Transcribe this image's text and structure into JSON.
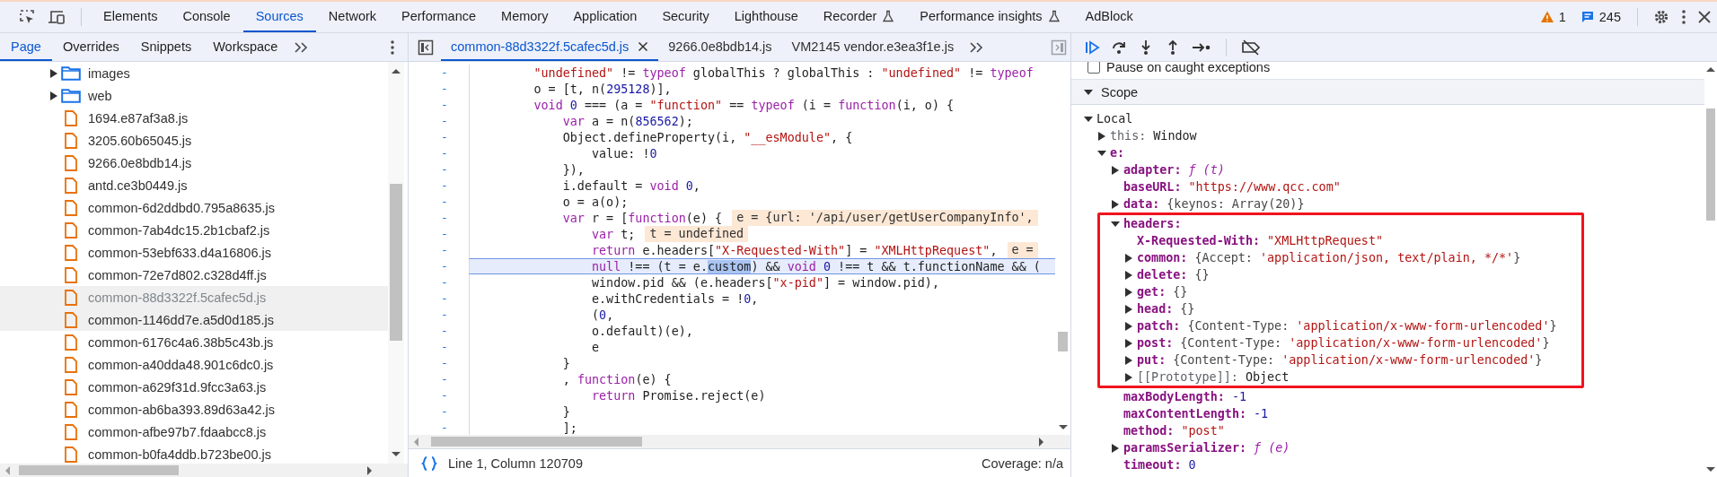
{
  "main_tabs": [
    {
      "label": "Elements",
      "selected": false,
      "experimental": false
    },
    {
      "label": "Console",
      "selected": false,
      "experimental": false
    },
    {
      "label": "Sources",
      "selected": true,
      "experimental": false
    },
    {
      "label": "Network",
      "selected": false,
      "experimental": false
    },
    {
      "label": "Performance",
      "selected": false,
      "experimental": false
    },
    {
      "label": "Memory",
      "selected": false,
      "experimental": false
    },
    {
      "label": "Application",
      "selected": false,
      "experimental": false
    },
    {
      "label": "Security",
      "selected": false,
      "experimental": false
    },
    {
      "label": "Lighthouse",
      "selected": false,
      "experimental": false
    },
    {
      "label": "Recorder",
      "selected": false,
      "experimental": true
    },
    {
      "label": "Performance insights",
      "selected": false,
      "experimental": true
    },
    {
      "label": "AdBlock",
      "selected": false,
      "experimental": false
    }
  ],
  "issues": {
    "warnings": "1",
    "messages": "245"
  },
  "navigator": {
    "tabs": [
      {
        "label": "Page",
        "selected": true
      },
      {
        "label": "Overrides",
        "selected": false
      },
      {
        "label": "Snippets",
        "selected": false
      },
      {
        "label": "Workspace",
        "selected": false
      }
    ],
    "tree": [
      {
        "kind": "folder",
        "name": "images",
        "expanded": false,
        "selected": false,
        "hovered": false
      },
      {
        "kind": "folder",
        "name": "web",
        "expanded": false,
        "selected": false,
        "hovered": false
      },
      {
        "kind": "file",
        "name": "1694.e87af3a8.js",
        "selected": false,
        "hovered": false
      },
      {
        "kind": "file",
        "name": "3205.60b65045.js",
        "selected": false,
        "hovered": false
      },
      {
        "kind": "file",
        "name": "9266.0e8bdb14.js",
        "selected": false,
        "hovered": false
      },
      {
        "kind": "file",
        "name": "antd.ce3b0449.js",
        "selected": false,
        "hovered": false
      },
      {
        "kind": "file",
        "name": "common-6d2ddbd0.795a8635.js",
        "selected": false,
        "hovered": false
      },
      {
        "kind": "file",
        "name": "common-7ab4dc15.2b1cbaf2.js",
        "selected": false,
        "hovered": false
      },
      {
        "kind": "file",
        "name": "common-53ebf633.d4a16806.js",
        "selected": false,
        "hovered": false
      },
      {
        "kind": "file",
        "name": "common-72e7d802.c328d4ff.js",
        "selected": false,
        "hovered": false
      },
      {
        "kind": "file",
        "name": "common-88d3322f.5cafec5d.js",
        "selected": true,
        "hovered": false
      },
      {
        "kind": "file",
        "name": "common-1146dd7e.a5d0d185.js",
        "selected": false,
        "hovered": true
      },
      {
        "kind": "file",
        "name": "common-6176c4a6.38b5c43b.js",
        "selected": false,
        "hovered": false
      },
      {
        "kind": "file",
        "name": "common-a40dda48.901c6dc0.js",
        "selected": false,
        "hovered": false
      },
      {
        "kind": "file",
        "name": "common-a629f31d.9fcc3a63.js",
        "selected": false,
        "hovered": false
      },
      {
        "kind": "file",
        "name": "common-ab6ba393.89d63a42.js",
        "selected": false,
        "hovered": false
      },
      {
        "kind": "file",
        "name": "common-afbe97b7.fdaabcc8.js",
        "selected": false,
        "hovered": false
      },
      {
        "kind": "file",
        "name": "common-b0fa4ddb.b723be00.js",
        "selected": false,
        "hovered": false
      }
    ]
  },
  "editor": {
    "tabs": [
      {
        "label": "common-88d3322f.5cafec5d.js",
        "selected": true
      },
      {
        "label": "9266.0e8bdb14.js",
        "selected": false
      },
      {
        "label": "VM2145 vendor.e3ea3f1e.js",
        "selected": false
      }
    ],
    "lines": [
      {
        "marker": "-",
        "current": false,
        "tokens": [
          {
            "kind": "string",
            "text": "        \"undefined\""
          },
          {
            "kind": "plain",
            "text": " != "
          },
          {
            "kind": "keyword",
            "text": "typeof"
          },
          {
            "kind": "plain",
            "text": " globalThis ? globalThis : "
          },
          {
            "kind": "string",
            "text": "\"undefined\""
          },
          {
            "kind": "plain",
            "text": " != "
          },
          {
            "kind": "keyword",
            "text": "typeof"
          }
        ]
      },
      {
        "marker": "-",
        "current": false,
        "tokens": [
          {
            "kind": "plain",
            "text": "        o = [t, n("
          },
          {
            "kind": "number",
            "text": "295128"
          },
          {
            "kind": "plain",
            "text": ")],"
          }
        ]
      },
      {
        "marker": "-",
        "current": false,
        "tokens": [
          {
            "kind": "keyword",
            "text": "        void "
          },
          {
            "kind": "number",
            "text": "0"
          },
          {
            "kind": "plain",
            "text": " === (a = "
          },
          {
            "kind": "string",
            "text": "\"function\""
          },
          {
            "kind": "plain",
            "text": " == "
          },
          {
            "kind": "keyword",
            "text": "typeof"
          },
          {
            "kind": "plain",
            "text": " (i = "
          },
          {
            "kind": "keyword",
            "text": "function"
          },
          {
            "kind": "plain",
            "text": "(i, o) {"
          }
        ]
      },
      {
        "marker": "-",
        "current": false,
        "tokens": [
          {
            "kind": "keyword",
            "text": "            var"
          },
          {
            "kind": "plain",
            "text": " a = n("
          },
          {
            "kind": "number",
            "text": "856562"
          },
          {
            "kind": "plain",
            "text": ");"
          }
        ]
      },
      {
        "marker": "-",
        "current": false,
        "tokens": [
          {
            "kind": "plain",
            "text": "            Object.defineProperty(i, "
          },
          {
            "kind": "string",
            "text": "\"__esModule\""
          },
          {
            "kind": "plain",
            "text": ", {"
          }
        ]
      },
      {
        "marker": "-",
        "current": false,
        "tokens": [
          {
            "kind": "plain",
            "text": "                value: !"
          },
          {
            "kind": "number",
            "text": "0"
          }
        ]
      },
      {
        "marker": "-",
        "current": false,
        "tokens": [
          {
            "kind": "plain",
            "text": "            }),"
          }
        ]
      },
      {
        "marker": "-",
        "current": false,
        "tokens": [
          {
            "kind": "plain",
            "text": "            i.default = "
          },
          {
            "kind": "keyword",
            "text": "void "
          },
          {
            "kind": "number",
            "text": "0"
          },
          {
            "kind": "plain",
            "text": ","
          }
        ]
      },
      {
        "marker": "-",
        "current": false,
        "tokens": [
          {
            "kind": "plain",
            "text": "            o = a(o);"
          }
        ]
      },
      {
        "marker": "-",
        "current": false,
        "tokens": [
          {
            "kind": "keyword",
            "text": "            var"
          },
          {
            "kind": "plain",
            "text": " r = ["
          },
          {
            "kind": "keyword",
            "text": "function"
          },
          {
            "kind": "plain",
            "text": "(e) {"
          }
        ],
        "inline_value": "e = {url: '/api/user/getUserCompanyInfo',"
      },
      {
        "marker": "-",
        "current": false,
        "tokens": [
          {
            "kind": "keyword",
            "text": "                var"
          },
          {
            "kind": "plain",
            "text": " t;"
          }
        ],
        "inline_value": "t = undefined"
      },
      {
        "marker": "-",
        "current": false,
        "tokens": [
          {
            "kind": "keyword",
            "text": "                return"
          },
          {
            "kind": "plain",
            "text": " e.headers["
          },
          {
            "kind": "string",
            "text": "\"X-Requested-With\""
          },
          {
            "kind": "plain",
            "text": "] = "
          },
          {
            "kind": "string",
            "text": "\"XMLHttpRequest\""
          },
          {
            "kind": "plain",
            "text": ","
          }
        ],
        "inline_value": "e ="
      },
      {
        "marker": "-",
        "current": true,
        "tokens": [
          {
            "kind": "keyword",
            "text": "                null"
          },
          {
            "kind": "plain",
            "text": " !== (t = e."
          },
          {
            "kind": "selection",
            "text": "custom"
          },
          {
            "kind": "plain",
            "text": ") && "
          },
          {
            "kind": "keyword",
            "text": "void "
          },
          {
            "kind": "number",
            "text": "0"
          },
          {
            "kind": "plain",
            "text": " !== t && t.functionName && ("
          }
        ]
      },
      {
        "marker": "-",
        "current": false,
        "tokens": [
          {
            "kind": "plain",
            "text": "                window.pid && (e.headers["
          },
          {
            "kind": "string",
            "text": "\"x-pid\""
          },
          {
            "kind": "plain",
            "text": "] = window.pid),"
          }
        ]
      },
      {
        "marker": "-",
        "current": false,
        "tokens": [
          {
            "kind": "plain",
            "text": "                e.withCredentials = !"
          },
          {
            "kind": "number",
            "text": "0"
          },
          {
            "kind": "plain",
            "text": ","
          }
        ]
      },
      {
        "marker": "-",
        "current": false,
        "tokens": [
          {
            "kind": "plain",
            "text": "                ("
          },
          {
            "kind": "number",
            "text": "0"
          },
          {
            "kind": "plain",
            "text": ","
          }
        ]
      },
      {
        "marker": "-",
        "current": false,
        "tokens": [
          {
            "kind": "plain",
            "text": "                o.default)(e),"
          }
        ]
      },
      {
        "marker": "-",
        "current": false,
        "tokens": [
          {
            "kind": "plain",
            "text": "                e"
          }
        ]
      },
      {
        "marker": "-",
        "current": false,
        "tokens": [
          {
            "kind": "plain",
            "text": "            }"
          }
        ]
      },
      {
        "marker": "-",
        "current": false,
        "tokens": [
          {
            "kind": "plain",
            "text": "            , "
          },
          {
            "kind": "keyword",
            "text": "function"
          },
          {
            "kind": "plain",
            "text": "(e) {"
          }
        ]
      },
      {
        "marker": "-",
        "current": false,
        "tokens": [
          {
            "kind": "keyword",
            "text": "                return"
          },
          {
            "kind": "plain",
            "text": " Promise.reject(e)"
          }
        ]
      },
      {
        "marker": "-",
        "current": false,
        "tokens": [
          {
            "kind": "plain",
            "text": "            }"
          }
        ]
      },
      {
        "marker": "-",
        "current": false,
        "tokens": [
          {
            "kind": "plain",
            "text": "            ];"
          }
        ]
      }
    ],
    "status": {
      "position": "Line 1, Column 120709",
      "coverage": "Coverage: n/a"
    }
  },
  "debugger": {
    "pause_on_caught": {
      "label": "Pause on caught exceptions",
      "checked": false
    },
    "scope": {
      "title": "Scope",
      "expanded": true,
      "tree": [
        {
          "key": "Local",
          "kind": "section",
          "expanded": true,
          "children": [
            {
              "key": "this:",
              "kind": "internal",
              "expanded": false,
              "value": [
                {
                  "kind": "plain",
                  "text": "Window"
                }
              ]
            },
            {
              "key": "e:",
              "kind": "property",
              "expanded": true,
              "children": [
                {
                  "key": "adapter:",
                  "kind": "property",
                  "expanded": false,
                  "highlighted": false,
                  "value": [
                    {
                      "kind": "function",
                      "text": "ƒ (t)"
                    }
                  ]
                },
                {
                  "key": "baseURL:",
                  "kind": "property",
                  "highlighted": false,
                  "value": [
                    {
                      "kind": "string",
                      "text": "\"https://www.qcc.com\""
                    }
                  ]
                },
                {
                  "key": "data:",
                  "kind": "property",
                  "expanded": false,
                  "highlighted": false,
                  "value": [
                    {
                      "kind": "preview",
                      "text": "{keynos: Array(20)}"
                    }
                  ]
                },
                {
                  "key": "headers:",
                  "kind": "property",
                  "expanded": true,
                  "highlighted": true,
                  "children": [
                    {
                      "key": "X-Requested-With:",
                      "kind": "property",
                      "value": [
                        {
                          "kind": "string",
                          "text": "\"XMLHttpRequest\""
                        }
                      ]
                    },
                    {
                      "key": "common:",
                      "kind": "property",
                      "expanded": false,
                      "value": [
                        {
                          "kind": "preview",
                          "text": "{Accept: "
                        },
                        {
                          "kind": "string",
                          "text": "'application/json, text/plain, */*'"
                        },
                        {
                          "kind": "preview",
                          "text": "}"
                        }
                      ]
                    },
                    {
                      "key": "delete:",
                      "kind": "property",
                      "expanded": false,
                      "value": [
                        {
                          "kind": "preview",
                          "text": "{}"
                        }
                      ]
                    },
                    {
                      "key": "get:",
                      "kind": "property",
                      "expanded": false,
                      "value": [
                        {
                          "kind": "preview",
                          "text": "{}"
                        }
                      ]
                    },
                    {
                      "key": "head:",
                      "kind": "property",
                      "expanded": false,
                      "value": [
                        {
                          "kind": "preview",
                          "text": "{}"
                        }
                      ]
                    },
                    {
                      "key": "patch:",
                      "kind": "property",
                      "expanded": false,
                      "value": [
                        {
                          "kind": "preview",
                          "text": "{Content-Type: "
                        },
                        {
                          "kind": "string",
                          "text": "'application/x-www-form-urlencoded'"
                        },
                        {
                          "kind": "preview",
                          "text": "}"
                        }
                      ]
                    },
                    {
                      "key": "post:",
                      "kind": "property",
                      "expanded": false,
                      "value": [
                        {
                          "kind": "preview",
                          "text": "{Content-Type: "
                        },
                        {
                          "kind": "string",
                          "text": "'application/x-www-form-urlencoded'"
                        },
                        {
                          "kind": "preview",
                          "text": "}"
                        }
                      ]
                    },
                    {
                      "key": "put:",
                      "kind": "property",
                      "expanded": false,
                      "value": [
                        {
                          "kind": "preview",
                          "text": "{Content-Type: "
                        },
                        {
                          "kind": "string",
                          "text": "'application/x-www-form-urlencoded'"
                        },
                        {
                          "kind": "preview",
                          "text": "}"
                        }
                      ]
                    },
                    {
                      "key": "[[Prototype]]:",
                      "kind": "internal",
                      "expanded": false,
                      "value": [
                        {
                          "kind": "plain",
                          "text": "Object"
                        }
                      ]
                    }
                  ]
                },
                {
                  "key": "maxBodyLength:",
                  "kind": "property",
                  "highlighted": false,
                  "value": [
                    {
                      "kind": "number",
                      "text": "-1"
                    }
                  ]
                },
                {
                  "key": "maxContentLength:",
                  "kind": "property",
                  "highlighted": false,
                  "value": [
                    {
                      "kind": "number",
                      "text": "-1"
                    }
                  ]
                },
                {
                  "key": "method:",
                  "kind": "property",
                  "highlighted": false,
                  "value": [
                    {
                      "kind": "string",
                      "text": "\"post\""
                    }
                  ]
                },
                {
                  "key": "paramsSerializer:",
                  "kind": "property",
                  "expanded": false,
                  "highlighted": false,
                  "value": [
                    {
                      "kind": "function",
                      "text": "ƒ (e)"
                    }
                  ]
                },
                {
                  "key": "timeout:",
                  "kind": "property",
                  "highlighted": false,
                  "value": [
                    {
                      "kind": "number",
                      "text": "0"
                    }
                  ]
                }
              ]
            }
          ]
        }
      ]
    }
  }
}
